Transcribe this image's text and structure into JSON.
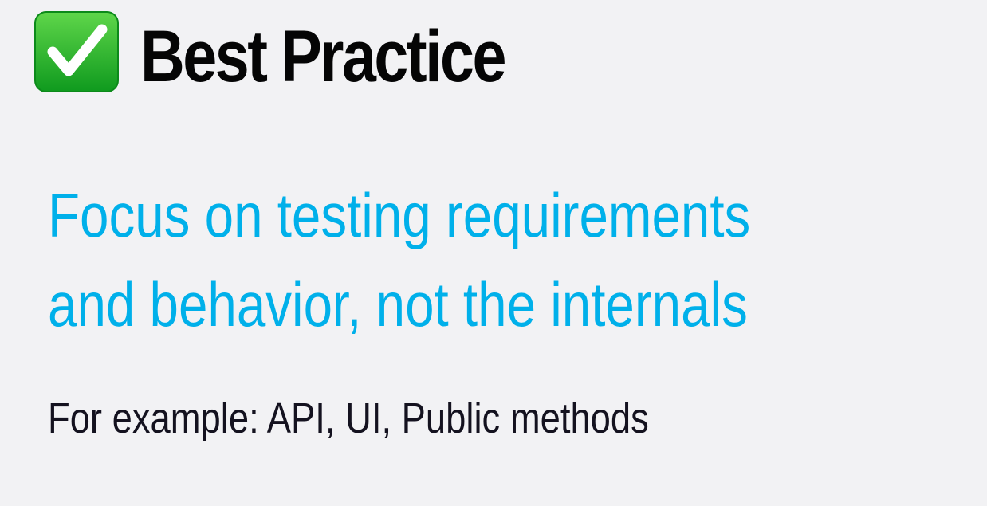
{
  "header": {
    "icon": "check-mark-button-icon",
    "title": "Best Practice"
  },
  "statement": {
    "line1": "Focus on testing requirements",
    "line2": "and behavior, not the internals"
  },
  "example": {
    "text": "For example: API, UI, Public methods"
  },
  "colors": {
    "background": "#f2f2f4",
    "title": "#050505",
    "statement": "#00b0ea",
    "example": "#14121f",
    "icon_green": "#22b02a"
  }
}
